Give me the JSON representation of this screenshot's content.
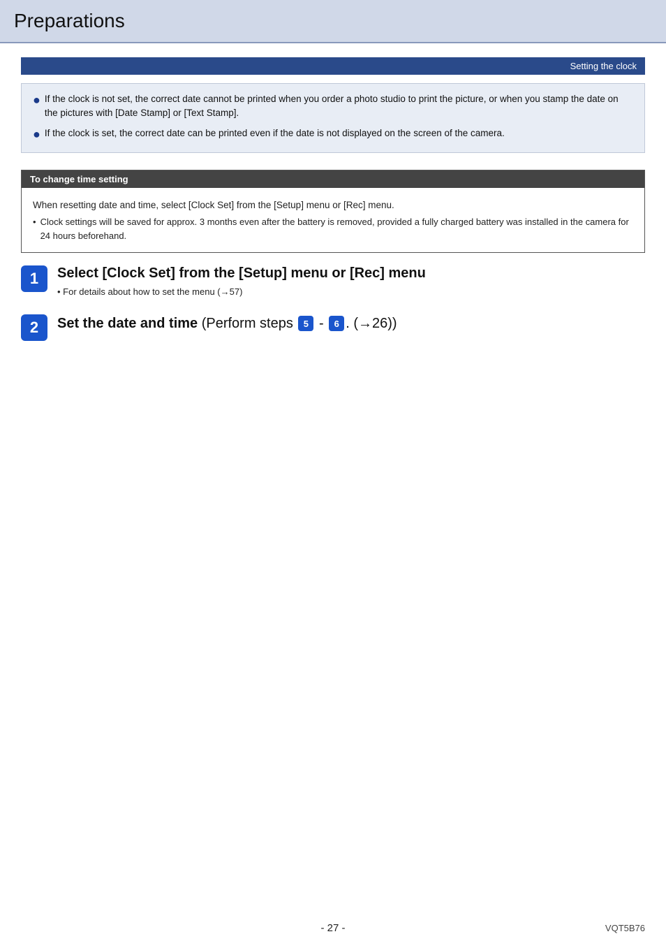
{
  "header": {
    "title": "Preparations"
  },
  "section_label": "Setting the clock",
  "note_box": {
    "items": [
      "If the clock is not set, the correct date cannot be printed when you order a photo studio to print the picture, or when you stamp the date on the pictures with [Date Stamp] or [Text Stamp].",
      "If the clock is set, the correct date can be printed even if the date is not displayed on the screen of the camera."
    ]
  },
  "change_time": {
    "header": "To change time setting",
    "description": "When resetting date and time, select [Clock Set] from the [Setup] menu or [Rec] menu.",
    "sub_note": "Clock settings will be saved for approx. 3 months even after the battery is removed, provided a fully charged battery was installed in the camera for 24 hours beforehand."
  },
  "steps": [
    {
      "number": "1",
      "title": "Select [Clock Set] from the [Setup] menu or [Rec] menu",
      "sub": "• For details about how to set the menu (→57)"
    },
    {
      "number": "2",
      "title_prefix": "Set the date and time",
      "title_suffix": " (Perform steps ",
      "badge1": "5",
      "between": " - ",
      "badge2": "6",
      "title_end": ". (→26))"
    }
  ],
  "footer": {
    "page": "- 27 -",
    "model": "VQT5B76"
  }
}
